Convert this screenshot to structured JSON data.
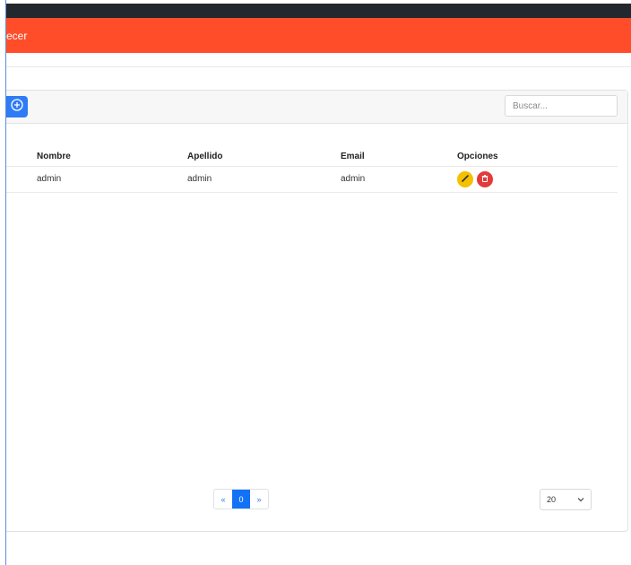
{
  "header": {
    "title": "ecer",
    "accent_color": "#ff4d2a"
  },
  "toolbar": {
    "add_icon": "plus-circle-icon",
    "search_placeholder": "Buscar..."
  },
  "table": {
    "columns": [
      "Nombre",
      "Apellido",
      "Email",
      "Opciones"
    ],
    "rows": [
      {
        "nombre": "admin",
        "apellido": "admin",
        "email": "admin",
        "actions": [
          "edit-icon",
          "delete-icon"
        ]
      }
    ]
  },
  "pagination": {
    "prev_label": "«",
    "current_page": "0",
    "next_label": "»"
  },
  "page_size": {
    "selected": "20"
  }
}
